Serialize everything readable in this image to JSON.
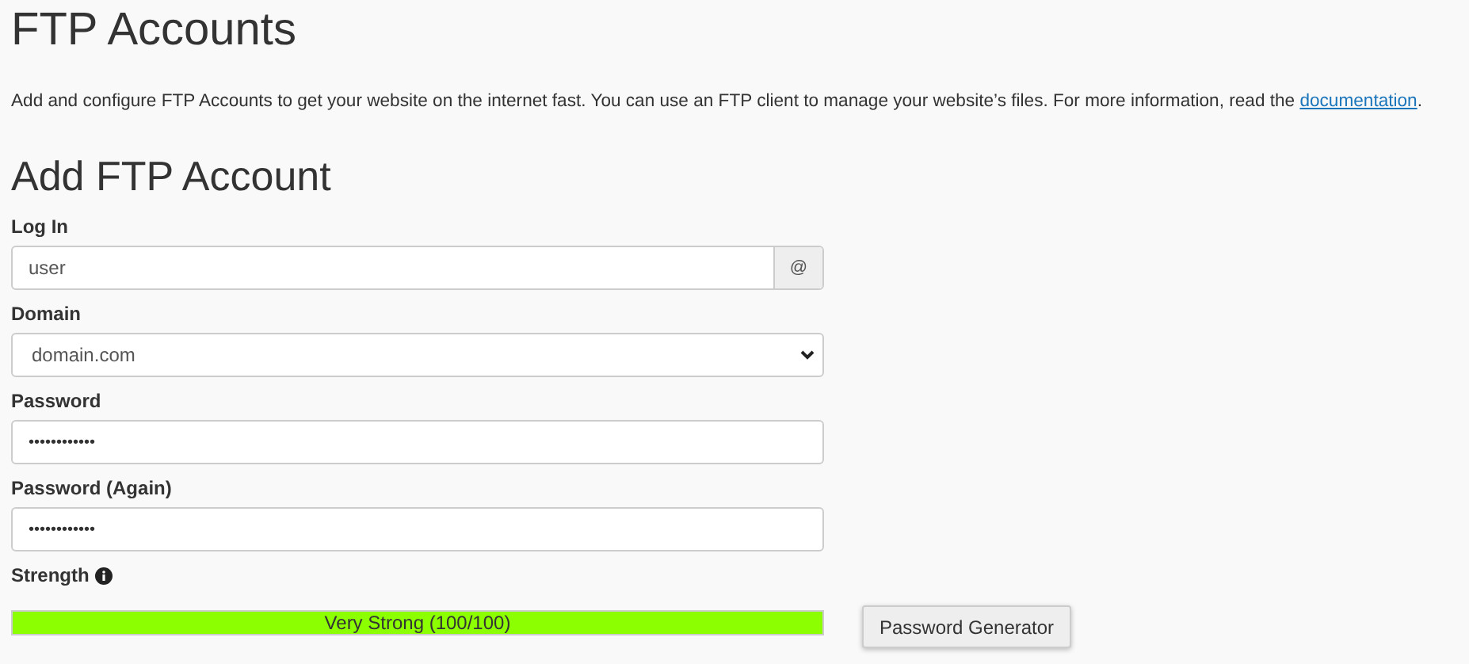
{
  "title": "FTP Accounts",
  "intro": {
    "text": "Add and configure FTP Accounts to get your website on the internet fast. You can use an FTP client to manage your website’s files. For more information, read the ",
    "link": "documentation",
    "after": "."
  },
  "form": {
    "heading": "Add FTP Account",
    "fields": [
      {
        "kind": "addon",
        "label": "Log In",
        "value": "user",
        "addon": "@"
      },
      {
        "kind": "select",
        "label": "Domain",
        "value": "domain.com"
      },
      {
        "kind": "password",
        "label": "Password",
        "value": "••••••••••••"
      },
      {
        "kind": "password",
        "label": "Password (Again)",
        "value": "••••••••••••"
      }
    ],
    "strength": {
      "label": "Strength",
      "level": 1,
      "reading": "Very Strong (100/100)"
    },
    "generator_button": "Password Generator"
  }
}
